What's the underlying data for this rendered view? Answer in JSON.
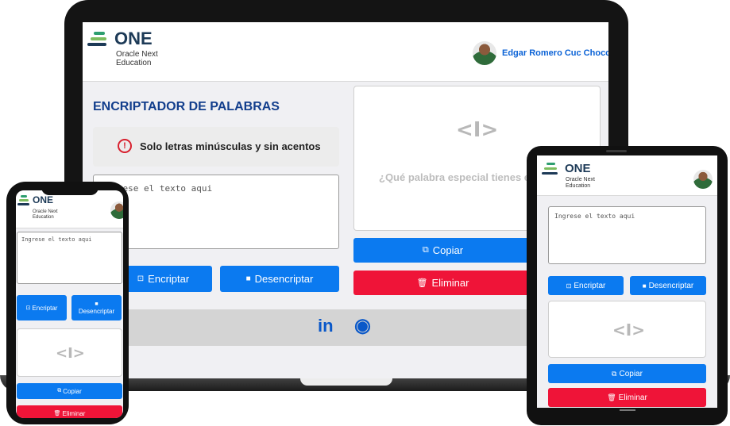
{
  "brand": {
    "name": "ONE",
    "line1": "Oracle Next",
    "line2": "Education",
    "bar_colors": [
      "#2e9e6f",
      "#7dbc5e",
      "#1d3a57"
    ]
  },
  "user": {
    "name": "Edgar Romero Cuc Choco"
  },
  "app": {
    "title": "ENCRIPTADOR DE PALABRAS",
    "warning": "Solo letras minúsculas y sin acentos",
    "warning_icon": "!",
    "input_placeholder": "Ingrese el texto aqui",
    "encrypt_label": "Encriptar",
    "decrypt_label": "Desencriptar",
    "copy_label": "Copiar",
    "delete_label": "Eliminar",
    "output_prompt": "¿Qué palabra especial tienes e",
    "cursor_glyph": "<I>"
  },
  "footer": {
    "linkedin": "in",
    "github": "◉"
  },
  "colors": {
    "primary": "#0b7af0",
    "danger": "#ef1438",
    "title": "#123e8c"
  }
}
